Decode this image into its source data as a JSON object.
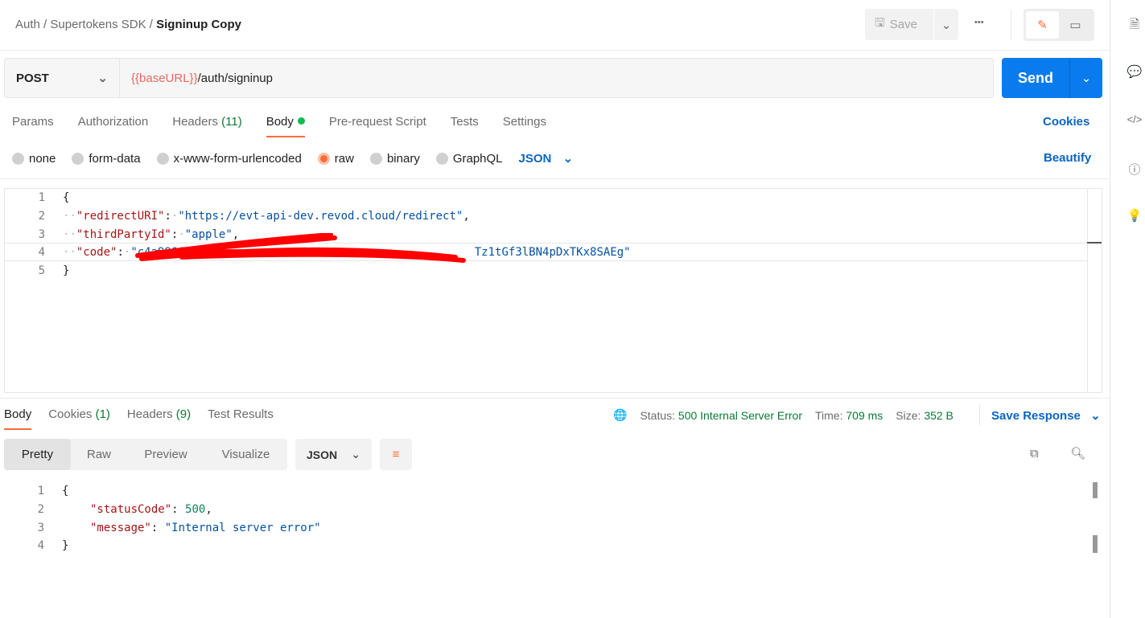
{
  "breadcrumb": {
    "items": [
      "Auth",
      "Supertokens SDK"
    ],
    "current": "Signinup Copy",
    "sep": "/"
  },
  "toolbar": {
    "save_label": "Save",
    "more": "•••"
  },
  "request": {
    "method": "POST",
    "url_var": "{{baseURL}}",
    "url_path": "/auth/signinup",
    "send_label": "Send"
  },
  "tabs": [
    {
      "label": "Params"
    },
    {
      "label": "Authorization"
    },
    {
      "label": "Headers",
      "count": "(11)"
    },
    {
      "label": "Body",
      "active": true
    },
    {
      "label": "Pre-request Script"
    },
    {
      "label": "Tests"
    },
    {
      "label": "Settings"
    }
  ],
  "cookies_label": "Cookies",
  "body_types": [
    "none",
    "form-data",
    "x-www-form-urlencoded",
    "raw",
    "binary",
    "GraphQL"
  ],
  "body_type_selected": "raw",
  "body_format": "JSON",
  "beautify_label": "Beautify",
  "request_body": {
    "line_numbers": [
      "1",
      "2",
      "3",
      "4",
      "5"
    ],
    "open": "{",
    "close": "}",
    "k1": "\"redirectURI\"",
    "v1": "\"https://evt-api-dev.revod.cloud/redirect\"",
    "k2": "\"thirdPartyId\"",
    "v2": "\"apple\"",
    "k3": "\"code\"",
    "v3_prefix": "\"c4a9906",
    "v3_tail": "Tz1tGf3lBN4pDxTKx8SAEg\""
  },
  "response": {
    "tabs": [
      {
        "label": "Body"
      },
      {
        "label": "Cookies",
        "count": "(1)"
      },
      {
        "label": "Headers",
        "count": "(9)"
      },
      {
        "label": "Test Results"
      }
    ],
    "status_label": "Status:",
    "status": "500 Internal Server Error",
    "time_label": "Time:",
    "time": "709 ms",
    "size_label": "Size:",
    "size": "352 B",
    "save_response": "Save Response",
    "views": [
      "Pretty",
      "Raw",
      "Preview",
      "Visualize"
    ],
    "format": "JSON",
    "line_numbers": [
      "1",
      "2",
      "3",
      "4"
    ],
    "k1": "\"statusCode\"",
    "v1": "500",
    "k2": "\"message\"",
    "v2": "\"Internal server error\"",
    "open": "{",
    "close": "}"
  },
  "colors": {
    "accent": "#ff6c37",
    "send": "#097bed",
    "link": "#0b65c2",
    "status_ok": "#0a7a35"
  }
}
